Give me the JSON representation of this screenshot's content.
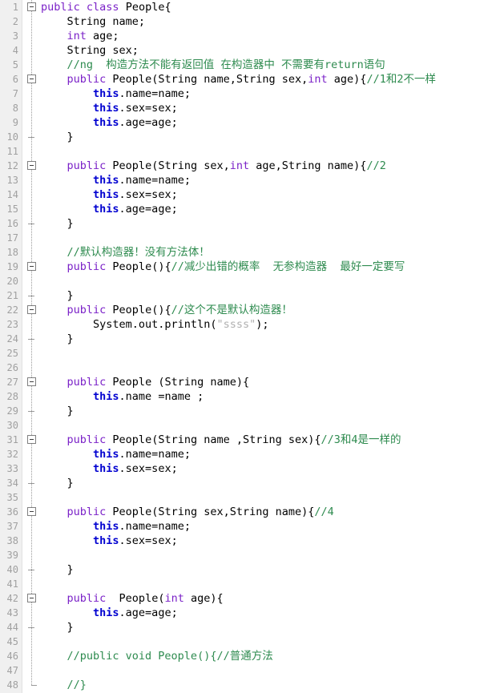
{
  "editor": {
    "title": "code-editor",
    "language": "java",
    "colors": {
      "background": "#ffffff",
      "gutter_background": "#f0f0f0",
      "line_number": "#a0a0a0",
      "keyword": "#7b22c8",
      "this_keyword": "#0000d0",
      "comment": "#2e8b4f",
      "string": "#b0b0b0",
      "text": "#000000",
      "fold_line": "#9a9a9a"
    },
    "first_line": 1,
    "last_line": 48,
    "total_lines": 48
  },
  "lines": [
    {
      "n": "1",
      "fold": "open",
      "tokens": [
        {
          "t": "public",
          "c": "kw"
        },
        {
          "t": " ",
          "c": "plain"
        },
        {
          "t": "class",
          "c": "kw"
        },
        {
          "t": " People{",
          "c": "plain"
        }
      ]
    },
    {
      "n": "2",
      "fold": "bar",
      "tokens": [
        {
          "t": "    String name;",
          "c": "plain"
        }
      ]
    },
    {
      "n": "3",
      "fold": "bar",
      "tokens": [
        {
          "t": "    ",
          "c": "plain"
        },
        {
          "t": "int",
          "c": "kw"
        },
        {
          "t": " age;",
          "c": "plain"
        }
      ]
    },
    {
      "n": "4",
      "fold": "bar",
      "tokens": [
        {
          "t": "    String sex;",
          "c": "plain"
        }
      ]
    },
    {
      "n": "5",
      "fold": "bar",
      "tokens": [
        {
          "t": "    //ng  构造方法不能有返回值 在构造器中 不需要有return语句",
          "c": "cmt"
        }
      ]
    },
    {
      "n": "6",
      "fold": "open",
      "tokens": [
        {
          "t": "    ",
          "c": "plain"
        },
        {
          "t": "public",
          "c": "kw"
        },
        {
          "t": " People(String name,String sex,",
          "c": "plain"
        },
        {
          "t": "int",
          "c": "kw"
        },
        {
          "t": " age){",
          "c": "plain"
        },
        {
          "t": "//1和2不一样",
          "c": "cmt"
        }
      ]
    },
    {
      "n": "7",
      "fold": "bar",
      "tokens": [
        {
          "t": "        ",
          "c": "plain"
        },
        {
          "t": "this",
          "c": "kw2"
        },
        {
          "t": ".name=name;",
          "c": "plain"
        }
      ]
    },
    {
      "n": "8",
      "fold": "bar",
      "tokens": [
        {
          "t": "        ",
          "c": "plain"
        },
        {
          "t": "this",
          "c": "kw2"
        },
        {
          "t": ".sex=sex;",
          "c": "plain"
        }
      ]
    },
    {
      "n": "9",
      "fold": "bar",
      "tokens": [
        {
          "t": "        ",
          "c": "plain"
        },
        {
          "t": "this",
          "c": "kw2"
        },
        {
          "t": ".age=age;",
          "c": "plain"
        }
      ]
    },
    {
      "n": "10",
      "fold": "end",
      "tokens": [
        {
          "t": "    }",
          "c": "plain"
        }
      ]
    },
    {
      "n": "11",
      "fold": "bar",
      "tokens": [
        {
          "t": "",
          "c": "plain"
        }
      ]
    },
    {
      "n": "12",
      "fold": "open",
      "tokens": [
        {
          "t": "    ",
          "c": "plain"
        },
        {
          "t": "public",
          "c": "kw"
        },
        {
          "t": " People(String sex,",
          "c": "plain"
        },
        {
          "t": "int",
          "c": "kw"
        },
        {
          "t": " age,String name){",
          "c": "plain"
        },
        {
          "t": "//2",
          "c": "cmt"
        }
      ]
    },
    {
      "n": "13",
      "fold": "bar",
      "tokens": [
        {
          "t": "        ",
          "c": "plain"
        },
        {
          "t": "this",
          "c": "kw2"
        },
        {
          "t": ".name=name;",
          "c": "plain"
        }
      ]
    },
    {
      "n": "14",
      "fold": "bar",
      "tokens": [
        {
          "t": "        ",
          "c": "plain"
        },
        {
          "t": "this",
          "c": "kw2"
        },
        {
          "t": ".sex=sex;",
          "c": "plain"
        }
      ]
    },
    {
      "n": "15",
      "fold": "bar",
      "tokens": [
        {
          "t": "        ",
          "c": "plain"
        },
        {
          "t": "this",
          "c": "kw2"
        },
        {
          "t": ".age=age;",
          "c": "plain"
        }
      ]
    },
    {
      "n": "16",
      "fold": "end",
      "tokens": [
        {
          "t": "    }",
          "c": "plain"
        }
      ]
    },
    {
      "n": "17",
      "fold": "bar",
      "tokens": [
        {
          "t": "",
          "c": "plain"
        }
      ]
    },
    {
      "n": "18",
      "fold": "bar",
      "tokens": [
        {
          "t": "    //默认构造器！没有方法体！",
          "c": "cmt"
        }
      ]
    },
    {
      "n": "19",
      "fold": "open",
      "tokens": [
        {
          "t": "    ",
          "c": "plain"
        },
        {
          "t": "public",
          "c": "kw"
        },
        {
          "t": " People(){",
          "c": "plain"
        },
        {
          "t": "//减少出错的概率  无参构造器  最好一定要写",
          "c": "cmt"
        }
      ]
    },
    {
      "n": "20",
      "fold": "bar",
      "tokens": [
        {
          "t": "",
          "c": "plain"
        }
      ]
    },
    {
      "n": "21",
      "fold": "end",
      "tokens": [
        {
          "t": "    }",
          "c": "plain"
        }
      ]
    },
    {
      "n": "22",
      "fold": "open",
      "tokens": [
        {
          "t": "    ",
          "c": "plain"
        },
        {
          "t": "public",
          "c": "kw"
        },
        {
          "t": " People(){",
          "c": "plain"
        },
        {
          "t": "//这个不是默认构造器！",
          "c": "cmt"
        }
      ]
    },
    {
      "n": "23",
      "fold": "bar",
      "tokens": [
        {
          "t": "        System.out.println(",
          "c": "plain"
        },
        {
          "t": "\"ssss\"",
          "c": "str"
        },
        {
          "t": ");",
          "c": "plain"
        }
      ]
    },
    {
      "n": "24",
      "fold": "end",
      "tokens": [
        {
          "t": "    }",
          "c": "plain"
        }
      ]
    },
    {
      "n": "25",
      "fold": "bar",
      "tokens": [
        {
          "t": "",
          "c": "plain"
        }
      ]
    },
    {
      "n": "26",
      "fold": "bar",
      "tokens": [
        {
          "t": "",
          "c": "plain"
        }
      ]
    },
    {
      "n": "27",
      "fold": "open",
      "tokens": [
        {
          "t": "    ",
          "c": "plain"
        },
        {
          "t": "public",
          "c": "kw"
        },
        {
          "t": " People (String name){",
          "c": "plain"
        }
      ]
    },
    {
      "n": "28",
      "fold": "bar",
      "tokens": [
        {
          "t": "        ",
          "c": "plain"
        },
        {
          "t": "this",
          "c": "kw2"
        },
        {
          "t": ".name =name ;",
          "c": "plain"
        }
      ]
    },
    {
      "n": "29",
      "fold": "end",
      "tokens": [
        {
          "t": "    }",
          "c": "plain"
        }
      ]
    },
    {
      "n": "30",
      "fold": "bar",
      "tokens": [
        {
          "t": "",
          "c": "plain"
        }
      ]
    },
    {
      "n": "31",
      "fold": "open",
      "tokens": [
        {
          "t": "    ",
          "c": "plain"
        },
        {
          "t": "public",
          "c": "kw"
        },
        {
          "t": " People(String name ,String sex){",
          "c": "plain"
        },
        {
          "t": "//3和4是一样的",
          "c": "cmt"
        }
      ]
    },
    {
      "n": "32",
      "fold": "bar",
      "tokens": [
        {
          "t": "        ",
          "c": "plain"
        },
        {
          "t": "this",
          "c": "kw2"
        },
        {
          "t": ".name=name;",
          "c": "plain"
        }
      ]
    },
    {
      "n": "33",
      "fold": "bar",
      "tokens": [
        {
          "t": "        ",
          "c": "plain"
        },
        {
          "t": "this",
          "c": "kw2"
        },
        {
          "t": ".sex=sex;",
          "c": "plain"
        }
      ]
    },
    {
      "n": "34",
      "fold": "end",
      "tokens": [
        {
          "t": "    }",
          "c": "plain"
        }
      ]
    },
    {
      "n": "35",
      "fold": "bar",
      "tokens": [
        {
          "t": "",
          "c": "plain"
        }
      ]
    },
    {
      "n": "36",
      "fold": "open",
      "tokens": [
        {
          "t": "    ",
          "c": "plain"
        },
        {
          "t": "public",
          "c": "kw"
        },
        {
          "t": " People(String sex,String name){",
          "c": "plain"
        },
        {
          "t": "//4",
          "c": "cmt"
        }
      ]
    },
    {
      "n": "37",
      "fold": "bar",
      "tokens": [
        {
          "t": "        ",
          "c": "plain"
        },
        {
          "t": "this",
          "c": "kw2"
        },
        {
          "t": ".name=name;",
          "c": "plain"
        }
      ]
    },
    {
      "n": "38",
      "fold": "bar",
      "tokens": [
        {
          "t": "        ",
          "c": "plain"
        },
        {
          "t": "this",
          "c": "kw2"
        },
        {
          "t": ".sex=sex;",
          "c": "plain"
        }
      ]
    },
    {
      "n": "39",
      "fold": "bar",
      "tokens": [
        {
          "t": "",
          "c": "plain"
        }
      ]
    },
    {
      "n": "40",
      "fold": "end",
      "tokens": [
        {
          "t": "    }",
          "c": "plain"
        }
      ]
    },
    {
      "n": "41",
      "fold": "bar",
      "tokens": [
        {
          "t": "",
          "c": "plain"
        }
      ]
    },
    {
      "n": "42",
      "fold": "open",
      "tokens": [
        {
          "t": "    ",
          "c": "plain"
        },
        {
          "t": "public",
          "c": "kw"
        },
        {
          "t": "  People(",
          "c": "plain"
        },
        {
          "t": "int",
          "c": "kw"
        },
        {
          "t": " age){",
          "c": "plain"
        }
      ]
    },
    {
      "n": "43",
      "fold": "bar",
      "tokens": [
        {
          "t": "        ",
          "c": "plain"
        },
        {
          "t": "this",
          "c": "kw2"
        },
        {
          "t": ".age=age;",
          "c": "plain"
        }
      ]
    },
    {
      "n": "44",
      "fold": "end",
      "tokens": [
        {
          "t": "    }",
          "c": "plain"
        }
      ]
    },
    {
      "n": "45",
      "fold": "bar",
      "tokens": [
        {
          "t": "",
          "c": "plain"
        }
      ]
    },
    {
      "n": "46",
      "fold": "bar",
      "tokens": [
        {
          "t": "    //public void People(){//普通方法",
          "c": "cmt"
        }
      ]
    },
    {
      "n": "47",
      "fold": "bar",
      "tokens": [
        {
          "t": "",
          "c": "plain"
        }
      ]
    },
    {
      "n": "48",
      "fold": "last",
      "tokens": [
        {
          "t": "    //}",
          "c": "cmt"
        }
      ]
    }
  ]
}
